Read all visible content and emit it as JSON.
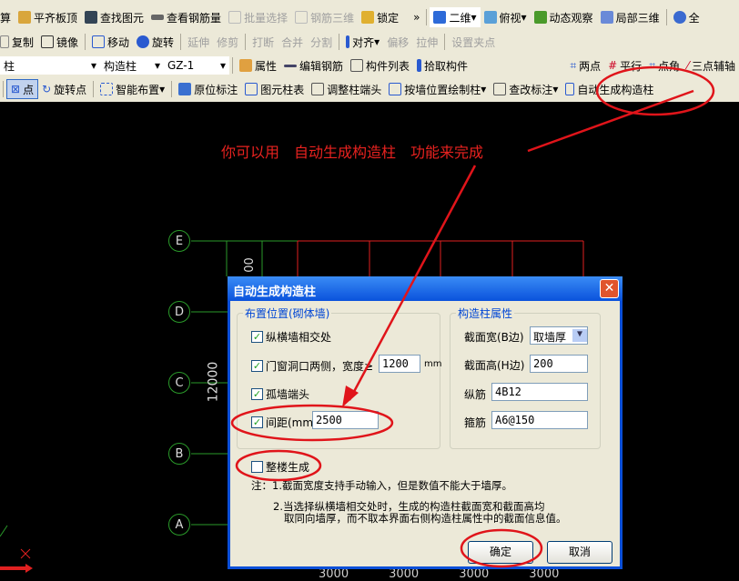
{
  "toolbar": {
    "row1": [
      "算",
      "平齐板顶",
      "查找图元",
      "查看钢筋量",
      "批量选择",
      "钢筋三维",
      "锁定",
      "»",
      "二维",
      "俯视",
      "动态观察",
      "局部三维",
      "全"
    ],
    "row2": [
      "复制",
      "镜像",
      "移动",
      "旋转",
      "延伸",
      "修剪",
      "打断",
      "合并",
      "分割",
      "对齐",
      "偏移",
      "拉伸",
      "设置夹点"
    ],
    "row3": {
      "type_select": "柱",
      "sub_select": "构造柱",
      "name_select": "GZ-1",
      "items": [
        "属性",
        "编辑钢筋",
        "构件列表",
        "拾取构件"
      ],
      "right_items": [
        "两点",
        "平行",
        "点角",
        "三点辅轴"
      ]
    },
    "row4": [
      "点",
      "旋转点",
      "智能布置",
      "原位标注",
      "图元柱表",
      "调整柱端头",
      "按墙位置绘制柱",
      "查改标注",
      "自动生成构造柱"
    ]
  },
  "annotation": {
    "text": "你可以用　自动生成构造柱　功能来完成",
    "color": "#e8221f"
  },
  "canvas": {
    "axes": [
      "E",
      "D",
      "C",
      "B",
      "A"
    ],
    "dimension": "12000",
    "dim_partial": "00",
    "bottom_dims": [
      "3000",
      "3000",
      "3000",
      "3000"
    ]
  },
  "dialog": {
    "title": "自动生成构造柱",
    "left_group": {
      "label": "布置位置(砌体墙)",
      "options": [
        {
          "label": "纵横墙相交处",
          "checked": true
        },
        {
          "label": "门窗洞口两侧，宽度≥",
          "checked": true,
          "value": "1200",
          "unit": "mm"
        },
        {
          "label": "孤墙端头",
          "checked": true
        },
        {
          "label": "间距(mm)",
          "checked": true,
          "value": "2500"
        }
      ]
    },
    "right_group": {
      "label": "构造柱属性",
      "fields": [
        {
          "label": "截面宽(B边)",
          "value": "取墙厚"
        },
        {
          "label": "截面高(H边)",
          "value": "200"
        },
        {
          "label": "纵筋",
          "value": "4B12"
        },
        {
          "label": "箍筋",
          "value": "A6@150"
        }
      ]
    },
    "whole_building": {
      "label": "整楼生成",
      "checked": false
    },
    "notes": [
      "注：1.截面宽度支持手动输入，但是数值不能大于墙厚。",
      "2.当选择纵横墙相交处时，生成的构造柱截面宽和截面高均",
      "取同向墙厚，而不取本界面右侧构造柱属性中的截面信息值。"
    ],
    "ok": "确定",
    "cancel": "取消"
  }
}
